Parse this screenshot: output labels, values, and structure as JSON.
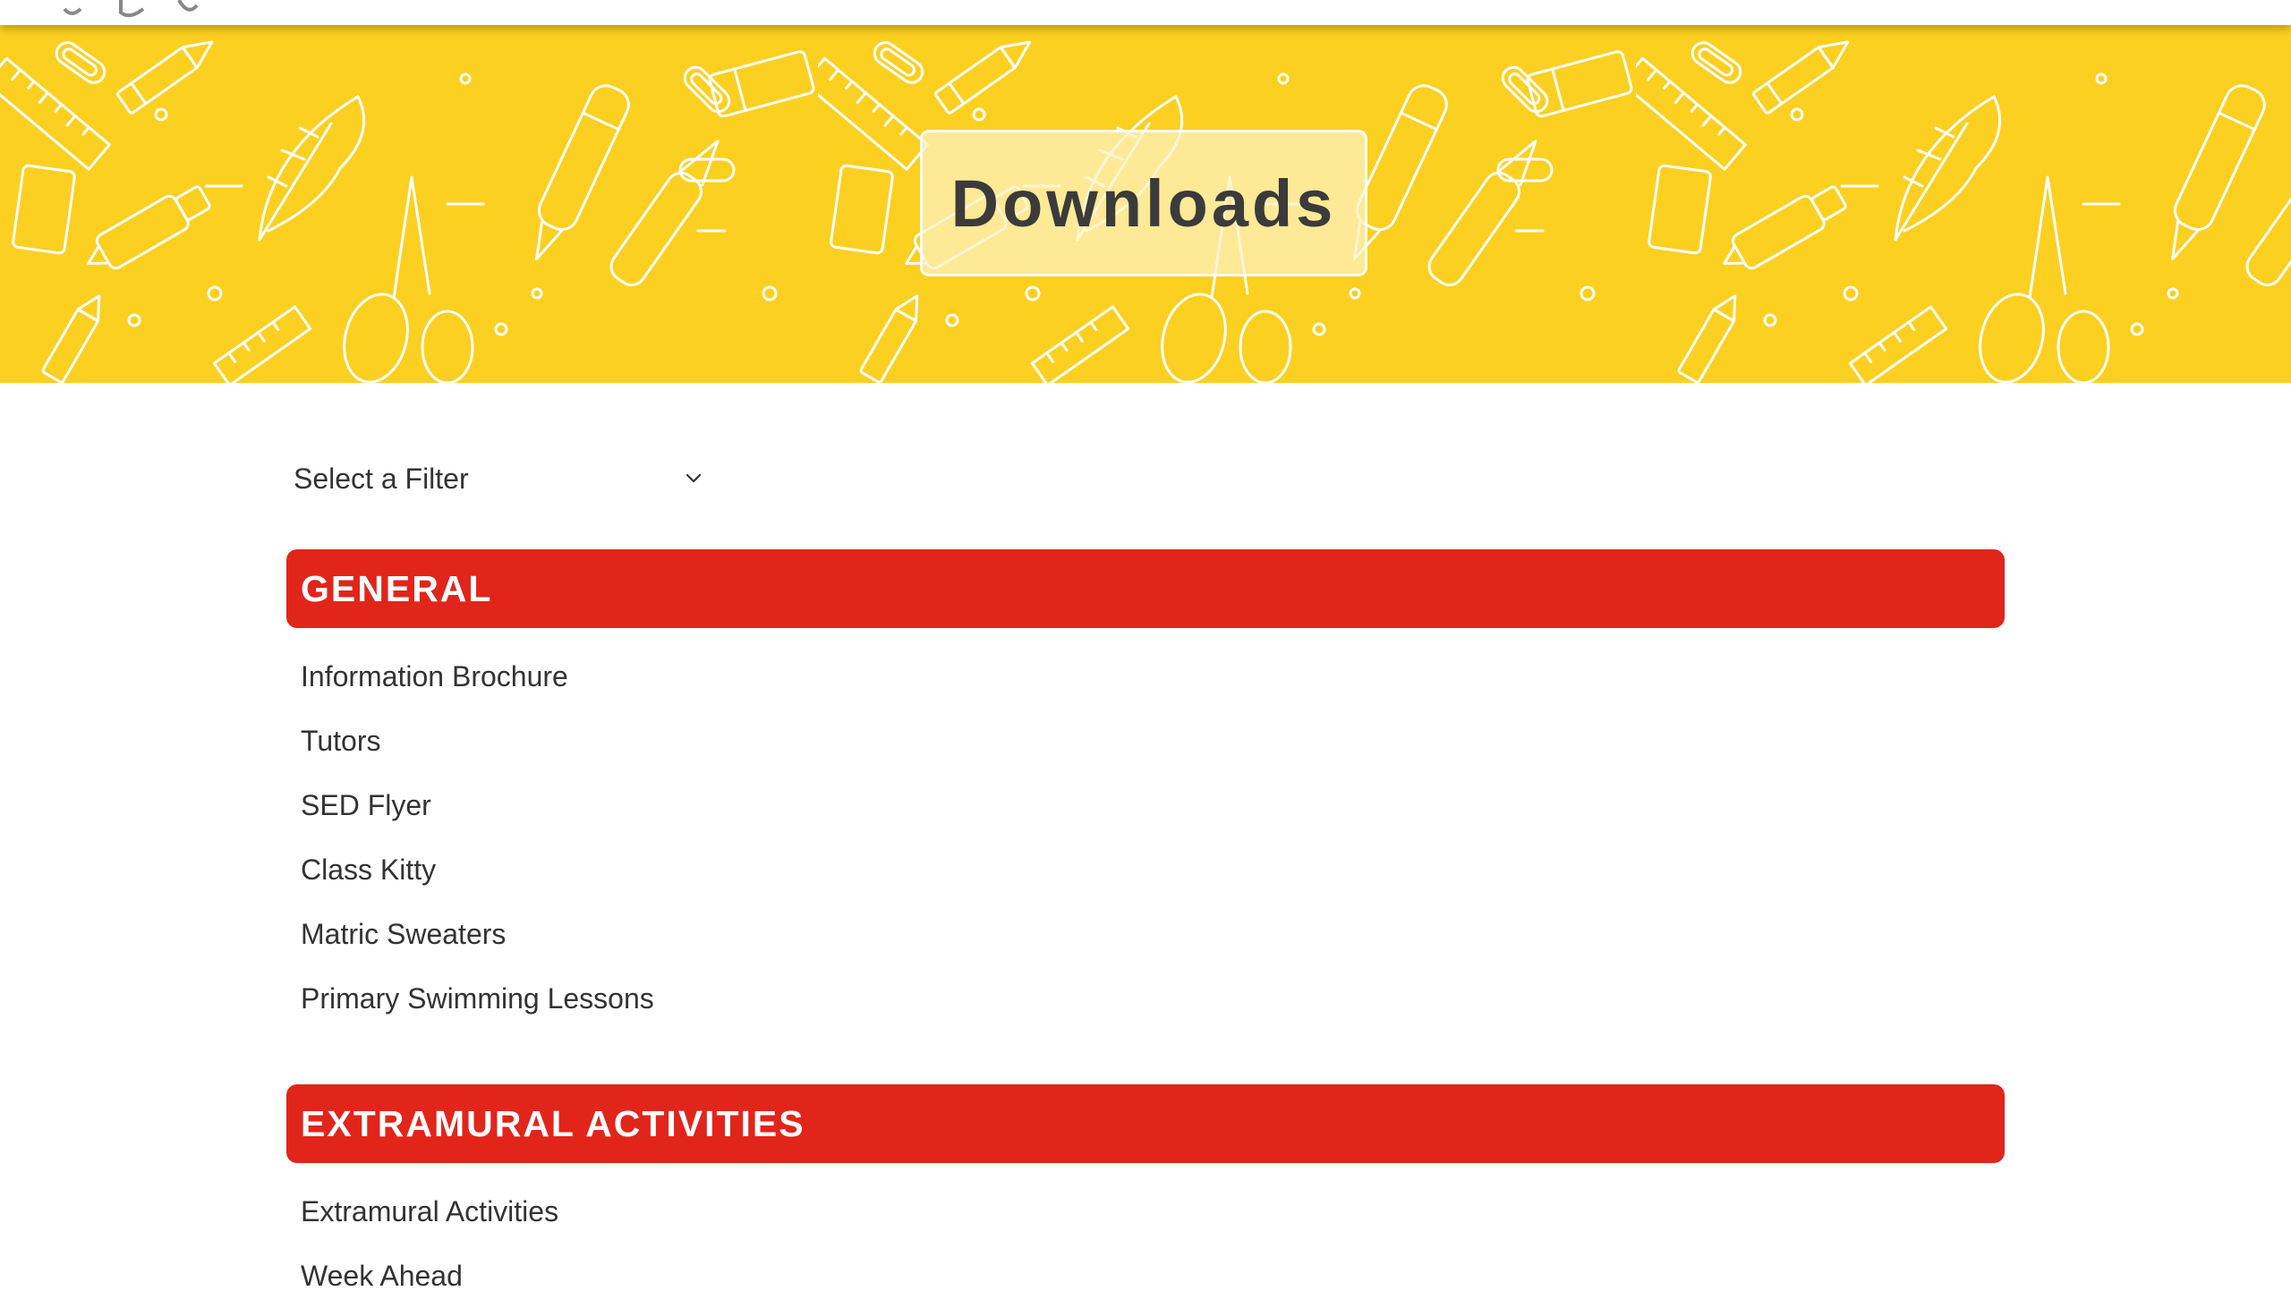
{
  "hero": {
    "title": "Downloads",
    "background_color": "#fcd020",
    "pattern_theme": "stationery-outline-pattern"
  },
  "filter": {
    "label": "Select a Filter",
    "icon": "chevron-down-icon"
  },
  "sections": [
    {
      "title": "GENERAL",
      "items": [
        "Information Brochure",
        "Tutors",
        "SED Flyer",
        "Class Kitty",
        "Matric Sweaters",
        "Primary Swimming Lessons"
      ]
    },
    {
      "title": "EXTRAMURAL ACTIVITIES",
      "items": [
        "Extramural Activities",
        "Week Ahead"
      ]
    }
  ],
  "colors": {
    "section_header": "#e1251b",
    "text": "#333333",
    "hero_yellow": "#fcd020"
  }
}
